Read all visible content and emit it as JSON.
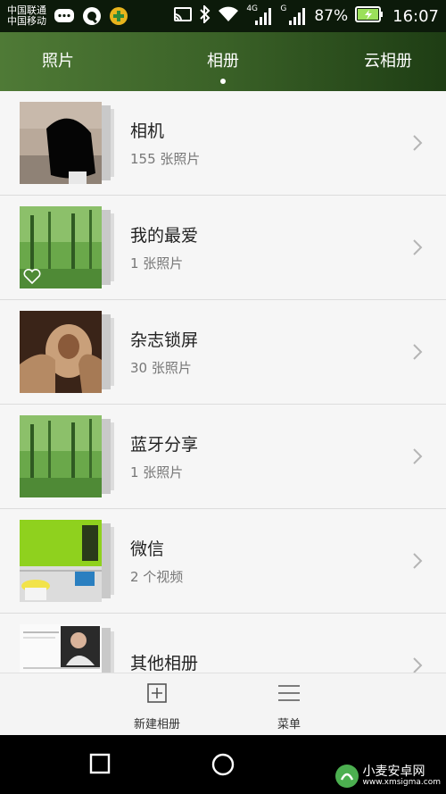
{
  "status_bar": {
    "carrier_1": "中国联通",
    "carrier_2": "中国移动",
    "network_1": "4G",
    "network_2": "G",
    "battery": "87%",
    "time": "16:07"
  },
  "tabs": [
    {
      "label": "照片",
      "active": false
    },
    {
      "label": "相册",
      "active": true
    },
    {
      "label": "云相册",
      "active": false
    }
  ],
  "albums": [
    {
      "name": "相机",
      "count": "155 张照片"
    },
    {
      "name": "我的最爱",
      "count": "1 张照片"
    },
    {
      "name": "杂志锁屏",
      "count": "30 张照片"
    },
    {
      "name": "蓝牙分享",
      "count": "1 张照片"
    },
    {
      "name": "微信",
      "count": "2 个视频"
    },
    {
      "name": "其他相册",
      "count": ""
    }
  ],
  "bottom_bar": {
    "new_album": "新建相册",
    "menu": "菜单"
  },
  "watermark": {
    "text": "小麦安卓网",
    "url": "www.xmsigma.com"
  },
  "colors": {
    "tab_bar_start": "#4f7a36",
    "tab_bar_end": "#1e3d14",
    "battery": "#9be05a"
  }
}
